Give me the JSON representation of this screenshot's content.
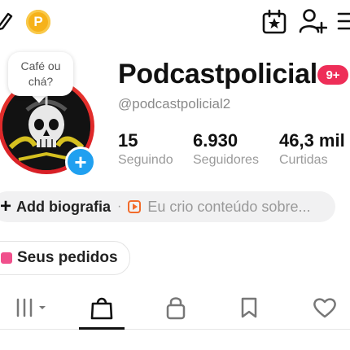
{
  "profile": {
    "username": "Podcastpolicial",
    "badge": "9+",
    "handle": "@podcastpolicial2",
    "bubble_line1": "Café ou",
    "bubble_line2": "chá?",
    "coin_label": "P",
    "add_symbol": "+"
  },
  "stats": [
    {
      "value": "15",
      "label": "Seguindo"
    },
    {
      "value": "6.930",
      "label": "Seguidores"
    },
    {
      "value": "46,3 mil",
      "label": "Curtidas"
    }
  ],
  "bio": {
    "plus": "+",
    "add_label": "Add biografia",
    "separator": "·",
    "hint": "Eu crio conteúdo sobre..."
  },
  "orders": {
    "label": "Seus pedidos"
  },
  "icons": {
    "edit": "pencil-icon",
    "coin": "coin-icon",
    "calendar": "calendar-star-icon",
    "add_friend": "add-user-icon",
    "menu": "menu-icon",
    "tabs": [
      "grid-icon",
      "shop-bag-icon",
      "lock-icon",
      "bookmark-icon",
      "heart-icon"
    ]
  },
  "colors": {
    "accent_red": "#e8352e",
    "badge_pink": "#ee2e58",
    "coin_gold": "#f6b21a",
    "add_blue": "#20a0f0",
    "hint_orange": "#f26b2a"
  }
}
